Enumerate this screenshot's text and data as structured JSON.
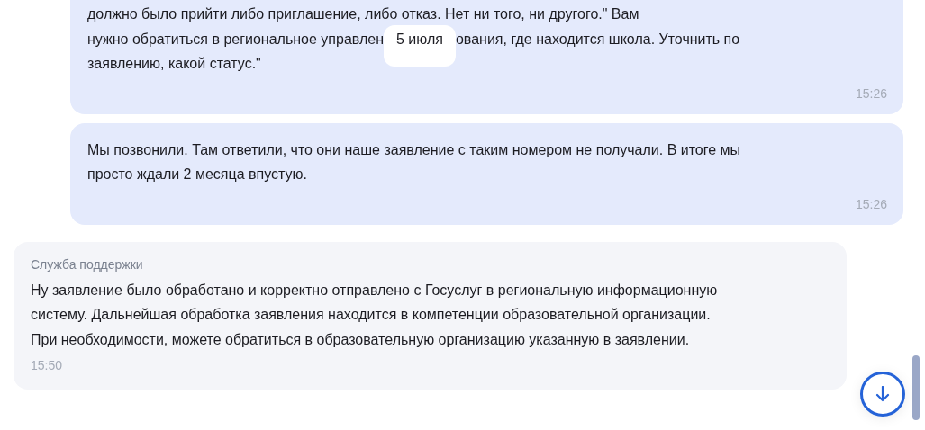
{
  "date_badge": "5 июля",
  "messages": [
    {
      "kind": "user",
      "lines": [
        [
          "должно было прийти либо приглашение, либо отказ. Нет ни того, ни другого.\" Вам"
        ],
        [
          "нужно обратиться в региональное управлен",
          "ования, где находится школа. Уточнить по"
        ],
        [
          "заявлению, какой статус.\""
        ]
      ],
      "time": "15:26"
    },
    {
      "kind": "user",
      "lines": [
        [
          "Мы позвонили. Там ответили, что они наше заявление с таким номером не получали. В итоге мы"
        ],
        [
          "просто ждали 2 месяца впустую."
        ]
      ],
      "time": "15:26"
    },
    {
      "kind": "support",
      "sender": "Служба поддержки",
      "lines": [
        [
          "Ну заявление было обработано и корректно отправлено с Госуслуг в региональную информационную"
        ],
        [
          "систему. Дальнейшая обработка заявления находится в компетенции образовательной организации."
        ],
        [
          "При необходимости, можете обратиться в образовательную организацию указанную в заявлении."
        ]
      ],
      "time": "15:50"
    }
  ]
}
